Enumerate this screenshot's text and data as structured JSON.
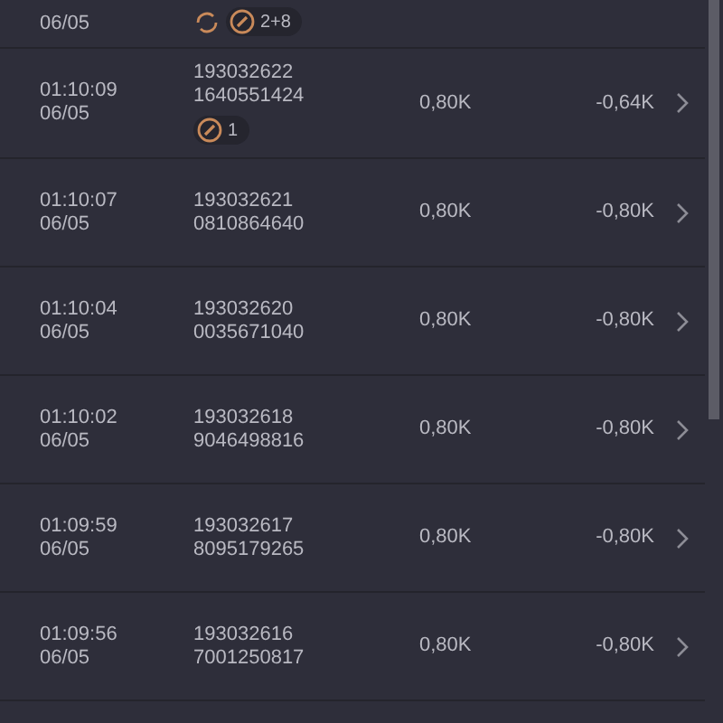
{
  "rows": [
    {
      "date": "06/05",
      "tags": [
        {
          "kind": "refresh"
        },
        {
          "kind": "pill",
          "count": "2+8"
        }
      ]
    },
    {
      "time": "01:10:09",
      "date": "06/05",
      "order_id": "193032622",
      "ticket_id": "1640551424",
      "amount": "0,80K",
      "profit": "-0,64K",
      "tags": [
        {
          "kind": "pill",
          "count": "1"
        }
      ]
    },
    {
      "time": "01:10:07",
      "date": "06/05",
      "order_id": "193032621",
      "ticket_id": "0810864640",
      "amount": "0,80K",
      "profit": "-0,80K"
    },
    {
      "time": "01:10:04",
      "date": "06/05",
      "order_id": "193032620",
      "ticket_id": "0035671040",
      "amount": "0,80K",
      "profit": "-0,80K"
    },
    {
      "time": "01:10:02",
      "date": "06/05",
      "order_id": "193032618",
      "ticket_id": "9046498816",
      "amount": "0,80K",
      "profit": "-0,80K"
    },
    {
      "time": "01:09:59",
      "date": "06/05",
      "order_id": "193032617",
      "ticket_id": "8095179265",
      "amount": "0,80K",
      "profit": "-0,80K"
    },
    {
      "time": "01:09:56",
      "date": "06/05",
      "order_id": "193032616",
      "ticket_id": "7001250817",
      "amount": "0,80K",
      "profit": "-0,80K"
    }
  ]
}
